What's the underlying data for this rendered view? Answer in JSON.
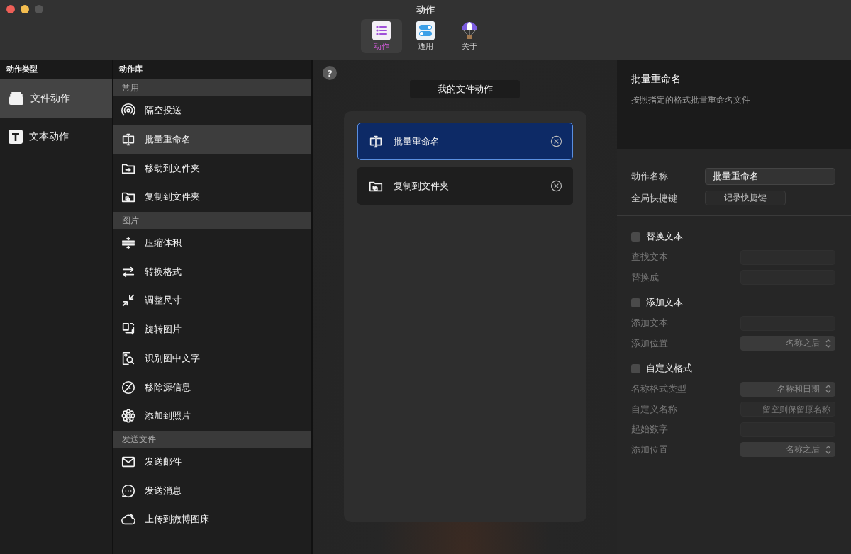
{
  "window": {
    "title": "动作"
  },
  "toolbar": [
    {
      "label": "动作",
      "selected": true
    },
    {
      "label": "通用",
      "selected": false
    },
    {
      "label": "关于",
      "selected": false
    }
  ],
  "sidebar": {
    "header": "动作类型",
    "items": [
      {
        "label": "文件动作",
        "selected": true
      },
      {
        "label": "文本动作",
        "selected": false
      }
    ]
  },
  "library": {
    "header": "动作库",
    "sections": [
      {
        "title": "常用",
        "items": [
          {
            "label": "隔空投送",
            "selected": false
          },
          {
            "label": "批量重命名",
            "selected": true
          },
          {
            "label": "移动到文件夹",
            "selected": false
          },
          {
            "label": "复制到文件夹",
            "selected": false
          }
        ]
      },
      {
        "title": "图片",
        "items": [
          {
            "label": "压缩体积",
            "selected": false
          },
          {
            "label": "转换格式",
            "selected": false
          },
          {
            "label": "调整尺寸",
            "selected": false
          },
          {
            "label": "旋转图片",
            "selected": false
          },
          {
            "label": "识别图中文字",
            "selected": false
          },
          {
            "label": "移除源信息",
            "selected": false
          },
          {
            "label": "添加到照片",
            "selected": false
          }
        ]
      },
      {
        "title": "发送文件",
        "items": [
          {
            "label": "发送邮件",
            "selected": false
          },
          {
            "label": "发送消息",
            "selected": false
          },
          {
            "label": "上传到微博图床",
            "selected": false
          }
        ]
      }
    ]
  },
  "workflow": {
    "help": "?",
    "title": "我的文件动作",
    "cards": [
      {
        "label": "批量重命名",
        "selected": true
      },
      {
        "label": "复制到文件夹",
        "selected": false
      }
    ]
  },
  "detail": {
    "title": "批量重命名",
    "description": "按照指定的格式批量重命名文件",
    "name_label": "动作名称",
    "name_value": "批量重命名",
    "shortcut_label": "全局快捷键",
    "shortcut_button": "记录快捷键",
    "groups": [
      {
        "label": "替换文本",
        "checked": false,
        "fields": [
          {
            "label": "查找文本",
            "kind": "text"
          },
          {
            "label": "替换成",
            "kind": "text"
          }
        ]
      },
      {
        "label": "添加文本",
        "checked": false,
        "fields": [
          {
            "label": "添加文本",
            "kind": "text"
          },
          {
            "label": "添加位置",
            "kind": "select",
            "value": "名称之后"
          }
        ]
      },
      {
        "label": "自定义格式",
        "checked": false,
        "fields": [
          {
            "label": "名称格式类型",
            "kind": "select",
            "value": "名称和日期"
          },
          {
            "label": "自定义名称",
            "kind": "text",
            "placeholder": "留空则保留原名称"
          },
          {
            "label": "起始数字",
            "kind": "text"
          },
          {
            "label": "添加位置",
            "kind": "select",
            "value": "名称之后"
          }
        ]
      }
    ]
  }
}
